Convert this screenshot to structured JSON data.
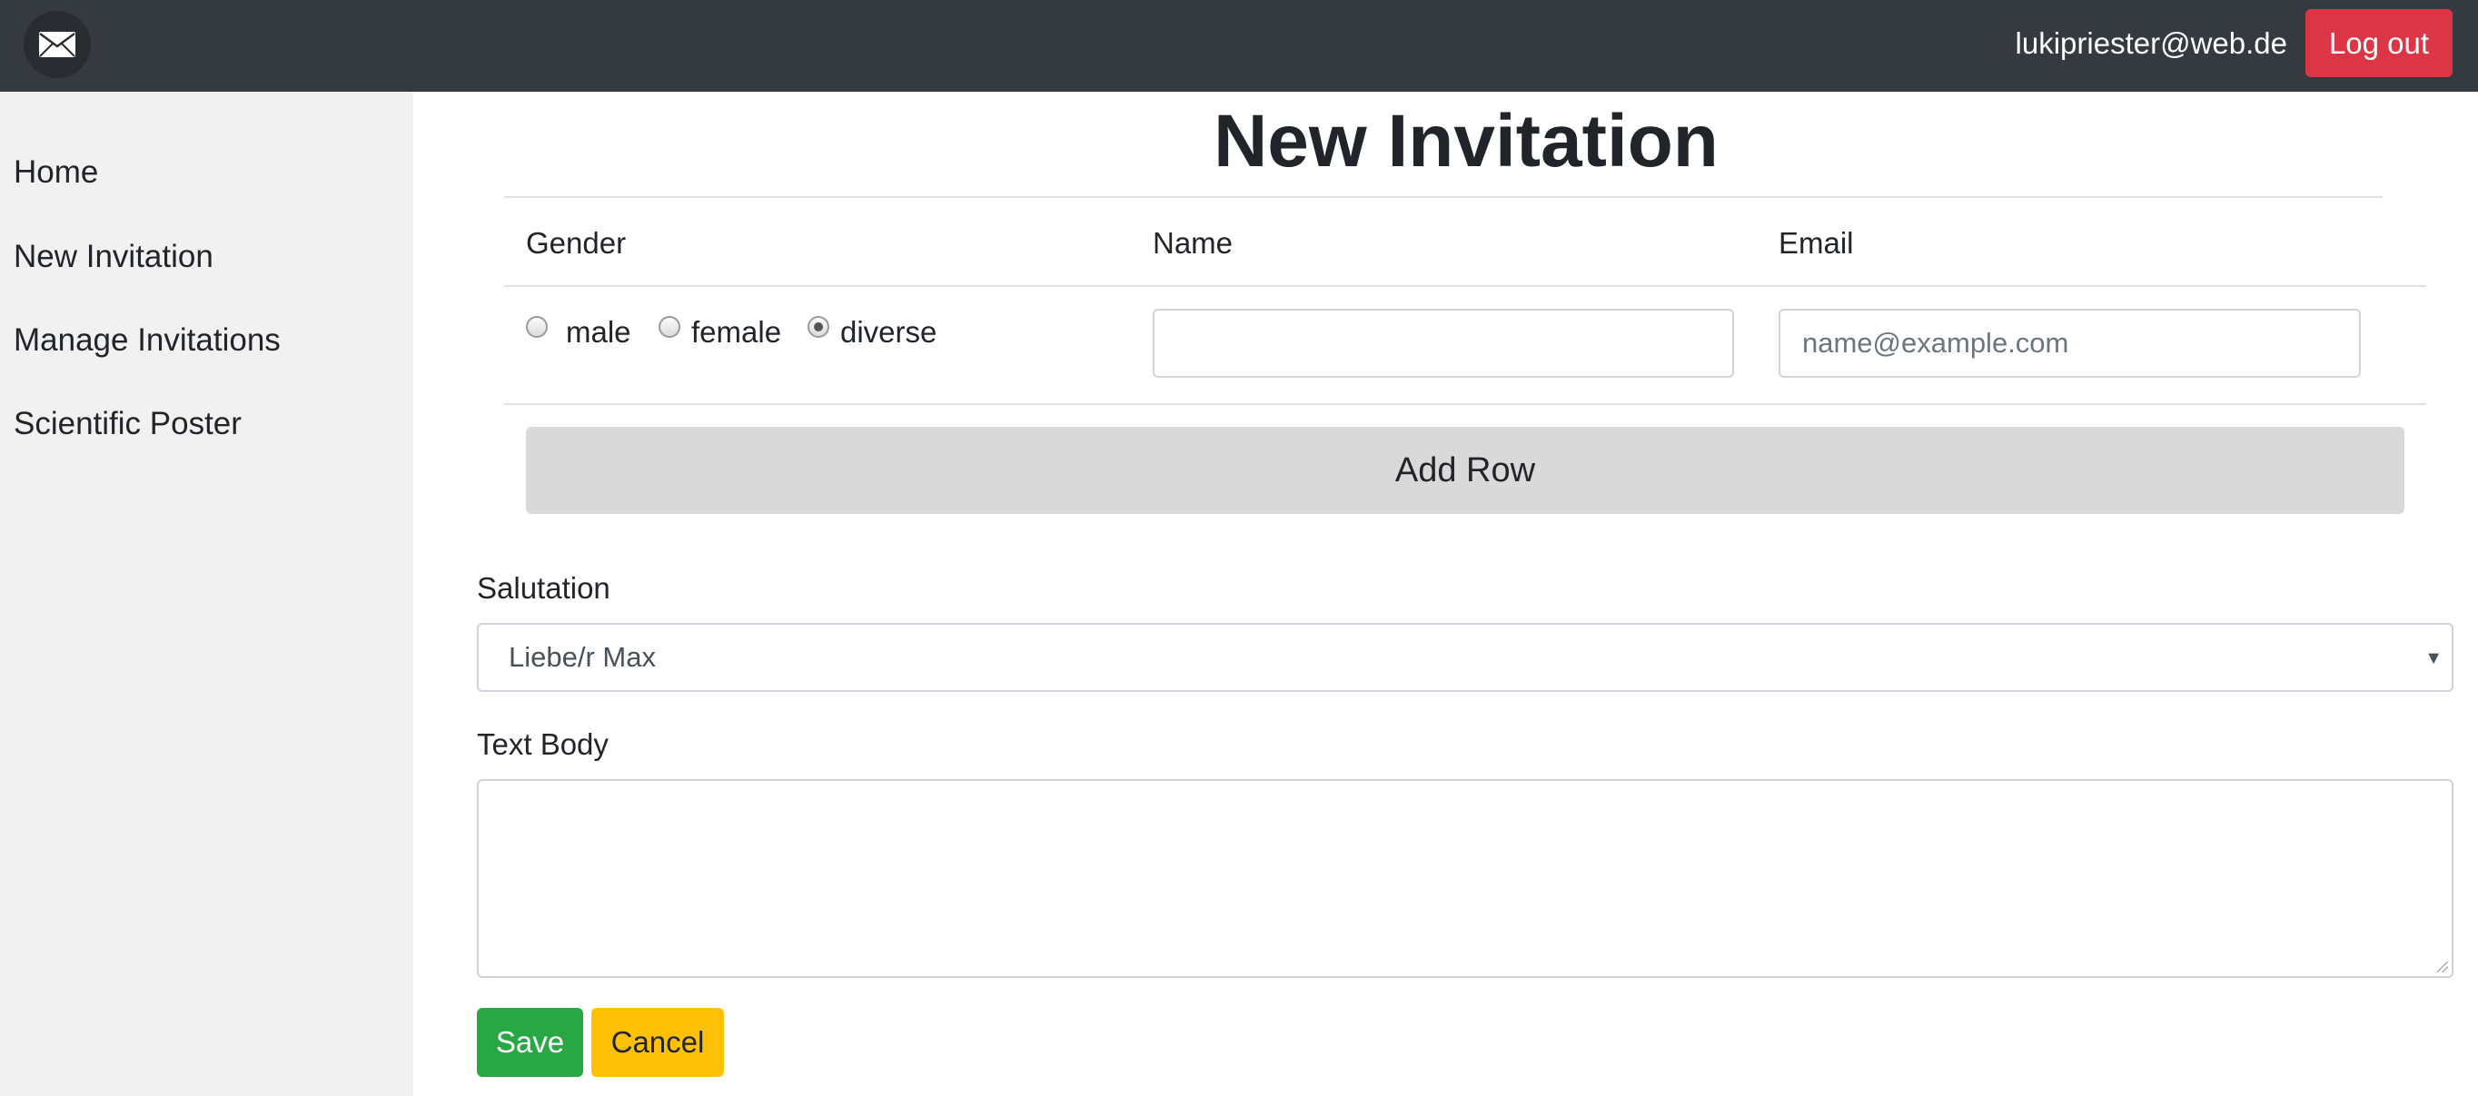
{
  "navbar": {
    "logo_icon": "envelope-icon",
    "user_email": "lukipriester@web.de",
    "logout_label": "Log out"
  },
  "sidebar": {
    "items": [
      {
        "label": "Home"
      },
      {
        "label": "New Invitation"
      },
      {
        "label": "Manage Invitations"
      },
      {
        "label": "Scientific Poster"
      }
    ]
  },
  "main": {
    "title": "New Invitation",
    "table": {
      "headers": [
        "Gender",
        "Name",
        "Email"
      ],
      "row": {
        "gender_options": [
          "male",
          "female",
          "diverse"
        ],
        "gender_selected": "diverse",
        "name_value": "",
        "email_placeholder": "name@example.com"
      }
    },
    "add_row_label": "Add Row",
    "salutation": {
      "label": "Salutation",
      "selected": "Liebe/r Max"
    },
    "text_body": {
      "label": "Text Body",
      "value": ""
    },
    "save_label": "Save",
    "cancel_label": "Cancel"
  },
  "colors": {
    "navbar": "#343a40",
    "logout": "#dc3545",
    "save": "#28a745",
    "cancel": "#ffc107",
    "add_row": "#d9d9d9",
    "sidebar": "#f1f1f1"
  }
}
